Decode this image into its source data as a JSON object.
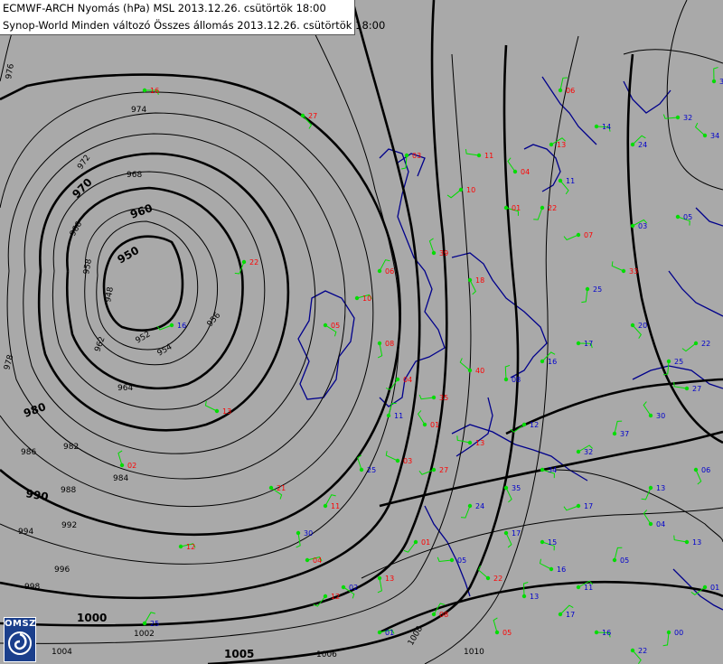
{
  "header": {
    "line1": "ECMWF-ARCH Nyomás (hPa) MSL 2013.12.26. csütörtök 18:00",
    "line2": "Synop-World Minden változó Összes állomás 2013.12.26. csütörtök 18:00"
  },
  "logo": {
    "text": "OMSZ"
  },
  "isobar_labels": [
    "974",
    "972",
    "970",
    "968",
    "966",
    "960",
    "958",
    "950",
    "948",
    "952",
    "954",
    "956",
    "962",
    "964",
    "976",
    "978",
    "980",
    "982",
    "984",
    "986",
    "988",
    "990",
    "992",
    "994",
    "996",
    "998",
    "1000",
    "1002",
    "1004",
    "1005",
    "1006",
    "1008",
    "1010"
  ],
  "station_labels": {
    "red": [
      "16",
      "27",
      "03",
      "10",
      "11",
      "04",
      "06",
      "13",
      "01",
      "18",
      "22",
      "07",
      "33",
      "39",
      "06",
      "10",
      "05",
      "08",
      "04",
      "35",
      "40",
      "44",
      "10",
      "22",
      "14",
      "13",
      "02",
      "05",
      "12",
      "21",
      "01",
      "12",
      "36"
    ],
    "blue": [
      "11",
      "25",
      "12",
      "17",
      "02",
      "11",
      "03",
      "05",
      "06",
      "13",
      "17",
      "16",
      "22",
      "00",
      "01",
      "13",
      "04",
      "05",
      "11",
      "15",
      "17",
      "08",
      "16",
      "17",
      "20",
      "25",
      "22",
      "27",
      "30",
      "37",
      "32",
      "34",
      "35",
      "24",
      "14"
    ]
  },
  "colors": {
    "background": "#a9a9a9",
    "isobar": "#000000",
    "coast": "#00008b",
    "station_green": "#00dd00",
    "temp_red": "#ff0000",
    "dew_blue": "#0000cc"
  }
}
